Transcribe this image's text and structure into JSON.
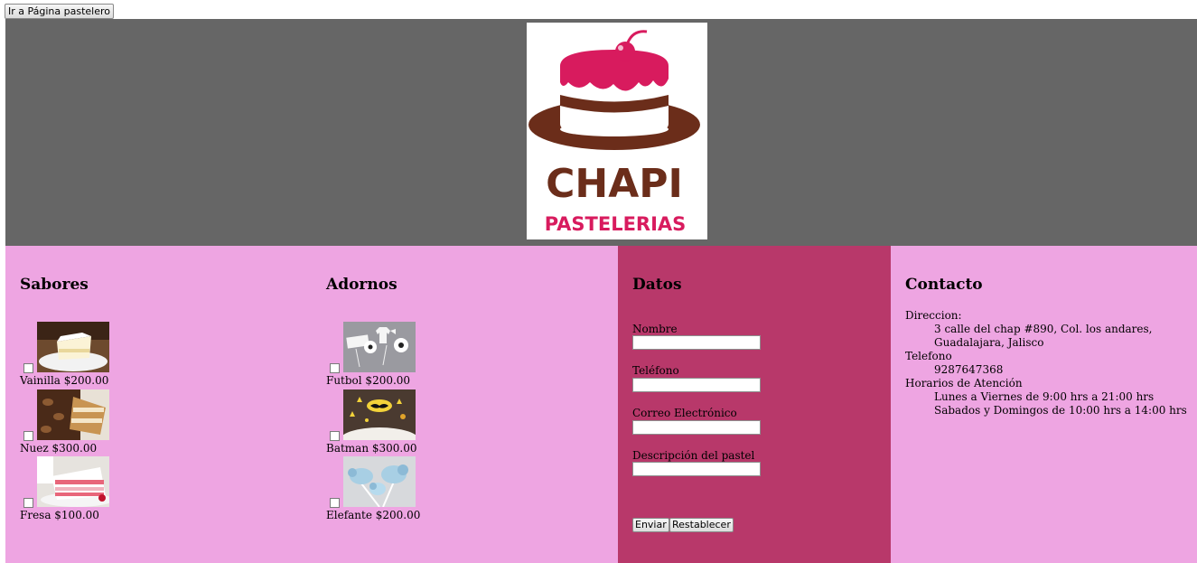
{
  "top_button": {
    "label": "Ir a Página pastelero"
  },
  "logo": {
    "line1": "CHAPI",
    "line2": "PASTELERIAS"
  },
  "sabores": {
    "title": "Sabores",
    "items": [
      {
        "label": "Vainilla $200.00"
      },
      {
        "label": "Nuez $300.00"
      },
      {
        "label": "Fresa $100.00"
      }
    ]
  },
  "adornos": {
    "title": "Adornos",
    "items": [
      {
        "label": "Futbol $200.00"
      },
      {
        "label": "Batman $300.00"
      },
      {
        "label": "Elefante $200.00"
      }
    ]
  },
  "datos": {
    "title": "Datos",
    "fields": [
      {
        "label": "Nombre"
      },
      {
        "label": "Teléfono"
      },
      {
        "label": "Correo Electrónico"
      },
      {
        "label": "Descripción del pastel"
      }
    ],
    "submit_label": "Enviar",
    "reset_label": "Restablecer"
  },
  "contacto": {
    "title": "Contacto",
    "direccion_label": "Direccion:",
    "direccion_value": "3 calle del chap #890, Col. los andares, Guadalajara, Jalisco",
    "telefono_label": "Telefono",
    "telefono_value": "9287647368",
    "horarios_label": "Horarios de Atención",
    "horario_1": "Lunes a Viernes de 9:00 hrs a 21:00 hrs",
    "horario_2": "Sabados y Domingos de 10:00 hrs a 14:00 hrs"
  },
  "colors": {
    "header_bg": "#666666",
    "panel_pink": "#eea5e2",
    "panel_magenta": "#b8386a",
    "logo_pink": "#d81b5e",
    "logo_brown": "#6b2d1a"
  }
}
